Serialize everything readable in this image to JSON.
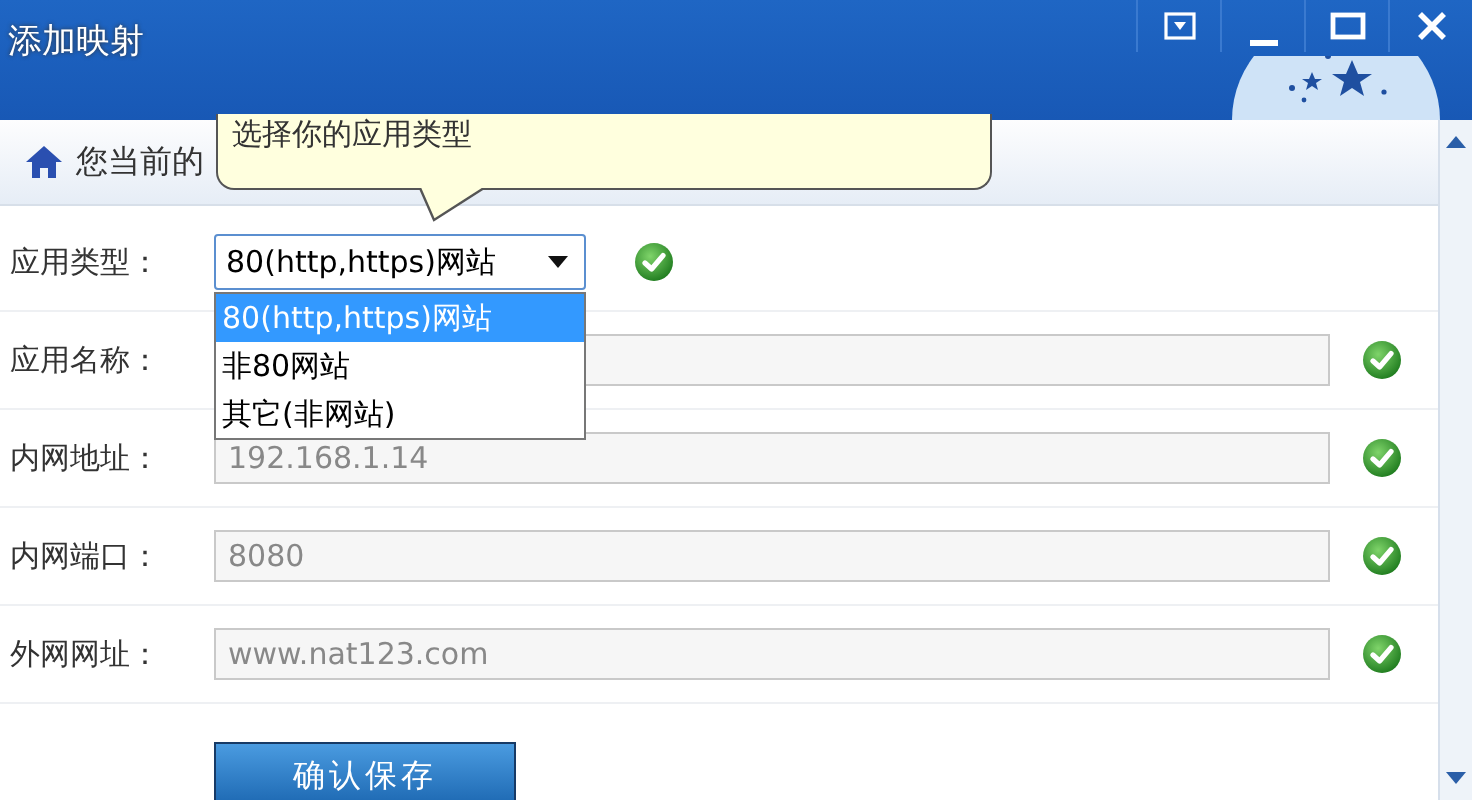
{
  "window": {
    "title": "添加映射"
  },
  "breadcrumb": {
    "prefix": "您当前的"
  },
  "tooltip": {
    "text": "选择你的应用类型"
  },
  "form": {
    "fields": [
      {
        "kind": "select",
        "label": "应用类型：",
        "value": "80(http,https)网站",
        "valid": true,
        "expanded": true,
        "options": [
          {
            "label": "80(http,https)网站",
            "selected": true
          },
          {
            "label": "非80网站",
            "selected": false
          },
          {
            "label": "其它(非网站)",
            "selected": false
          }
        ]
      },
      {
        "kind": "text",
        "label": "应用名称：",
        "valid": true
      },
      {
        "kind": "text",
        "label": "内网地址：",
        "value": "192.168.1.14",
        "valid": true
      },
      {
        "kind": "text",
        "label": "内网端口：",
        "value": "8080",
        "valid": true
      },
      {
        "kind": "text",
        "label": "外网网址：",
        "value": "www.nat123.com",
        "valid": true
      }
    ]
  },
  "save_button": "确认保存"
}
